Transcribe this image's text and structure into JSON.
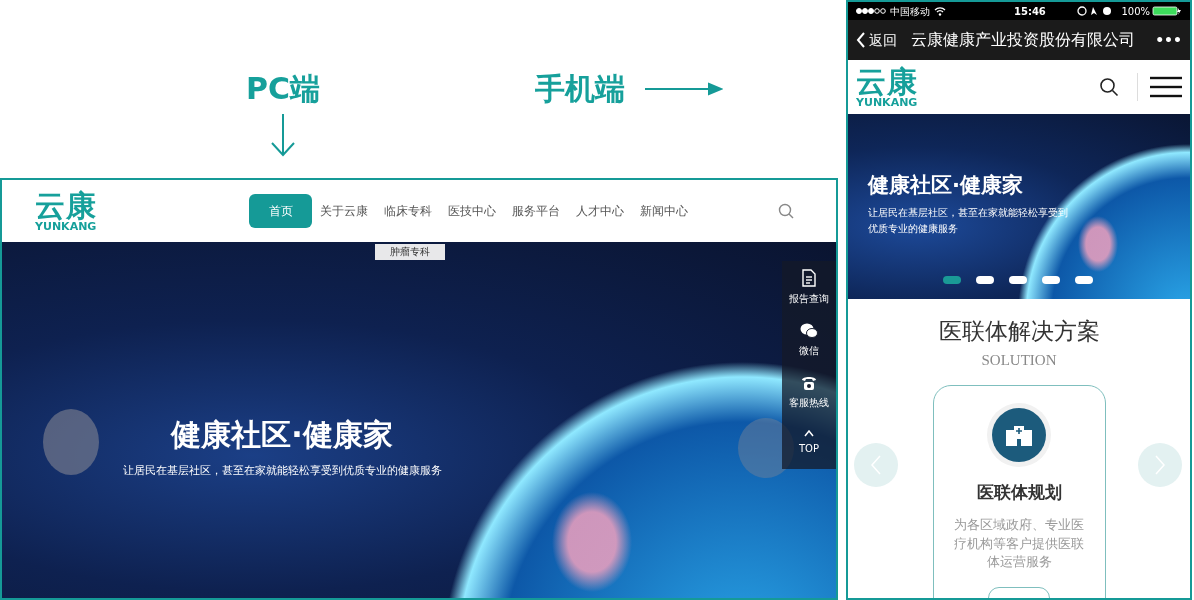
{
  "annotations": [
    {
      "kind": "down",
      "label": "PC端"
    },
    {
      "kind": "right",
      "label": "手机端"
    }
  ],
  "pc": {
    "logo": {
      "text": "云康",
      "sub": "YUNKANG"
    },
    "nav": [
      {
        "label": "首页",
        "selected": true
      },
      {
        "label": "关于云康",
        "selected": false
      },
      {
        "label": "临床专科",
        "selected": false,
        "submenu": [
          "肿瘤专科"
        ]
      },
      {
        "label": "医技中心",
        "selected": false
      },
      {
        "label": "服务平台",
        "selected": false
      },
      {
        "label": "人才中心",
        "selected": false
      },
      {
        "label": "新闻中心",
        "selected": false
      }
    ],
    "hero": {
      "title": "健康社区·健康家",
      "subtitle": "让居民在基层社区，甚至在家就能轻松享受到优质专业的健康服务"
    },
    "side_tools": [
      {
        "kind": "report",
        "label": "报告查询"
      },
      {
        "kind": "wechat",
        "label": "微信"
      },
      {
        "kind": "phone",
        "label": "客服热线"
      },
      {
        "kind": "top",
        "label": "TOP"
      }
    ]
  },
  "phone": {
    "status_bar": {
      "carrier": "中国移动",
      "time": "15:46",
      "battery": "100%"
    },
    "nav_bar": {
      "back": "返回",
      "title": "云康健康产业投资股份有限公司",
      "more": "•••"
    },
    "logo": {
      "text": "云康",
      "sub": "YUNKANG"
    },
    "banner": {
      "title": "健康社区·健康家",
      "subtitle": "让居民在基层社区，甚至在家就能轻松享受到优质专业的健康服务",
      "dots": [
        {
          "selected": true
        },
        {
          "selected": false
        },
        {
          "selected": false
        },
        {
          "selected": false
        },
        {
          "selected": false
        }
      ]
    },
    "section": {
      "title": "医联体解决方案",
      "subtitle": "SOLUTION"
    },
    "card": {
      "title": "医联体规划",
      "text": "为各区域政府、专业医疗机构等客户提供医联体运营服务"
    }
  }
}
